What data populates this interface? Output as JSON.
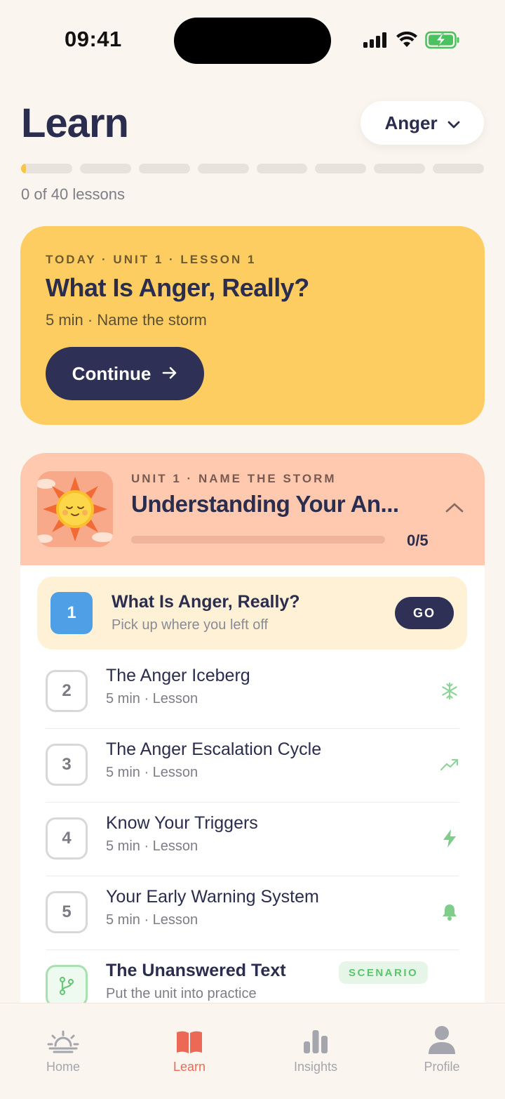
{
  "status_bar": {
    "time": "09:41"
  },
  "header": {
    "title": "Learn",
    "topic_select": {
      "value": "Anger"
    },
    "progress": {
      "completed": 0,
      "total": 40,
      "segments": 8,
      "first_segment_fill": 0.1,
      "label": "0 of 40 lessons"
    }
  },
  "today_card": {
    "eyebrow": "TODAY · UNIT 1 · LESSON 1",
    "title": "What Is Anger, Really?",
    "meta": "5 min · Name the storm",
    "button_label": "Continue"
  },
  "unit": {
    "eyebrow": "UNIT 1 · NAME THE STORM",
    "title": "Understanding Your An...",
    "progress_fraction": 0,
    "count": "0/5",
    "active_lesson": {
      "number": "1",
      "title": "What Is Anger, Really?",
      "subtitle": "Pick up where you left off",
      "button_label": "GO"
    },
    "lessons": [
      {
        "number": "2",
        "title": "The Anger Iceberg",
        "subtitle": "5 min · Lesson",
        "icon": "snowflake-icon"
      },
      {
        "number": "3",
        "title": "The Anger Escalation Cycle",
        "subtitle": "5 min · Lesson",
        "icon": "trend-up-icon"
      },
      {
        "number": "4",
        "title": "Know Your Triggers",
        "subtitle": "5 min · Lesson",
        "icon": "lightning-icon"
      },
      {
        "number": "5",
        "title": "Your Early Warning System",
        "subtitle": "5 min · Lesson",
        "icon": "bell-icon"
      }
    ],
    "scenario": {
      "title": "The Unanswered Text",
      "tag": "SCENARIO",
      "subtitle": "Put the unit into practice",
      "icon": "branch-icon"
    }
  },
  "tab_bar": {
    "tabs": [
      {
        "label": "Home",
        "icon": "sunrise-icon"
      },
      {
        "label": "Learn",
        "icon": "book-icon",
        "active": true
      },
      {
        "label": "Insights",
        "icon": "bar-chart-icon"
      },
      {
        "label": "Profile",
        "icon": "person-icon"
      }
    ]
  },
  "colors": {
    "background": "#FAF5EE",
    "navy": "#2B2D4E",
    "today_card": "#FDCD62",
    "unit_header": "#FEC9AE",
    "accent_green": "#5BC46E",
    "accent_active_tab": "#EC6A55",
    "lesson_badge_blue": "#4E9FE6"
  }
}
